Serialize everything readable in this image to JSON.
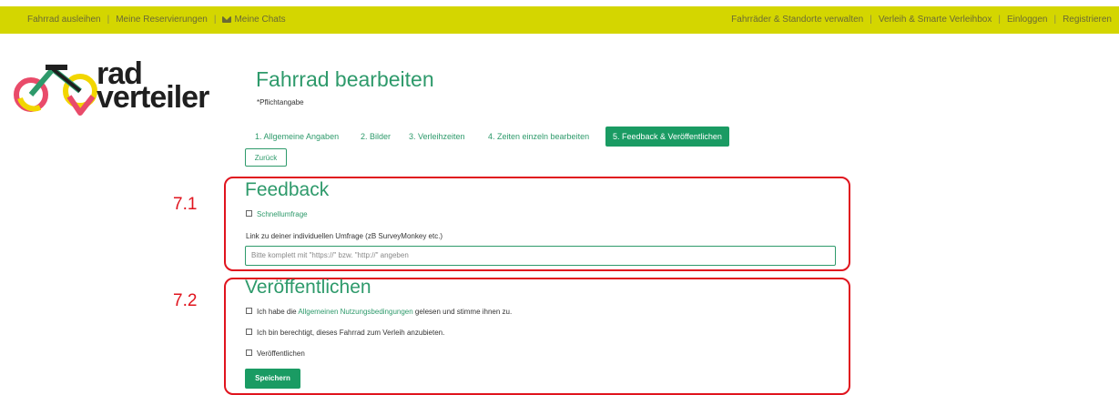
{
  "topnav": {
    "left": [
      "Fahrrad ausleihen",
      "Meine Reservierungen",
      "Meine Chats"
    ],
    "right": [
      "Fahrräder & Standorte verwalten",
      "Verleih & Smarte Verleihbox",
      "Einloggen",
      "Registrieren"
    ],
    "chat_icon": "envelope-icon"
  },
  "logo": {
    "line1": "rad",
    "line2": "verteiler"
  },
  "page": {
    "title": "Fahrrad bearbeiten",
    "required_note": "*Pflichtangabe"
  },
  "tabs": [
    "1. Allgemeine Angaben",
    "2. Bilder",
    "3. Verleihzeiten",
    "4. Zeiten einzeln bearbeiten",
    "5. Feedback & Veröffentlichen"
  ],
  "back_button": "Zurück",
  "annotations": {
    "a1": "7.1",
    "a2": "7.2"
  },
  "feedback": {
    "title": "Feedback",
    "quick_survey": "Schnellumfrage",
    "link_label": "Link zu deiner individuellen Umfrage (zB SurveyMonkey etc.)",
    "placeholder": "Bitte komplett mit \"https://\" bzw. \"http://\" angeben"
  },
  "publish": {
    "title": "Veröffentlichen",
    "terms_pre": "Ich habe die ",
    "terms_link": "Allgemeinen Nutzungsbedingungen",
    "terms_post": " gelesen und stimme ihnen zu.",
    "authorized": "Ich bin berechtigt, dieses Fahrrad zum Verleih anzubieten.",
    "publish_label": "Veröffentlichen",
    "save": "Speichern"
  },
  "colors": {
    "topbar": "#d4d600",
    "accent": "#2e9a6b",
    "primary": "#1a9b63",
    "annotation": "#e0141e"
  }
}
